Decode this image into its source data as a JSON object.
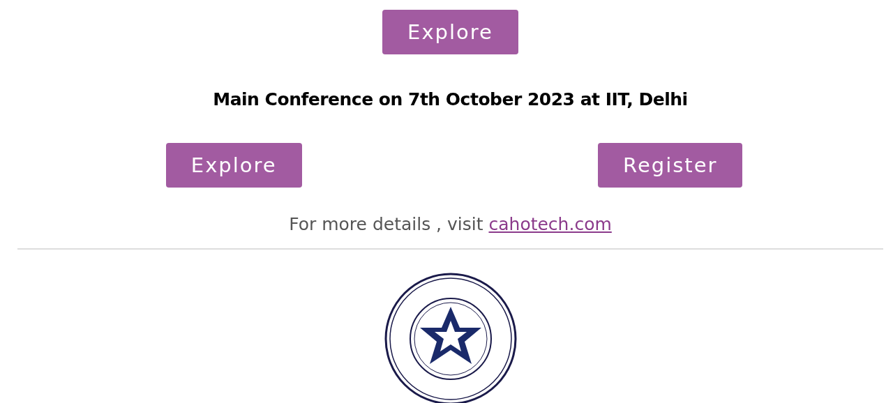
{
  "top_button": {
    "label": "Explore"
  },
  "heading": "Main Conference on 7th October 2023 at IIT, Delhi",
  "buttons": [
    {
      "label": "Explore"
    },
    {
      "label": "Register"
    }
  ],
  "details": {
    "text": "For more details , visit ",
    "link": "cahotech.com"
  }
}
